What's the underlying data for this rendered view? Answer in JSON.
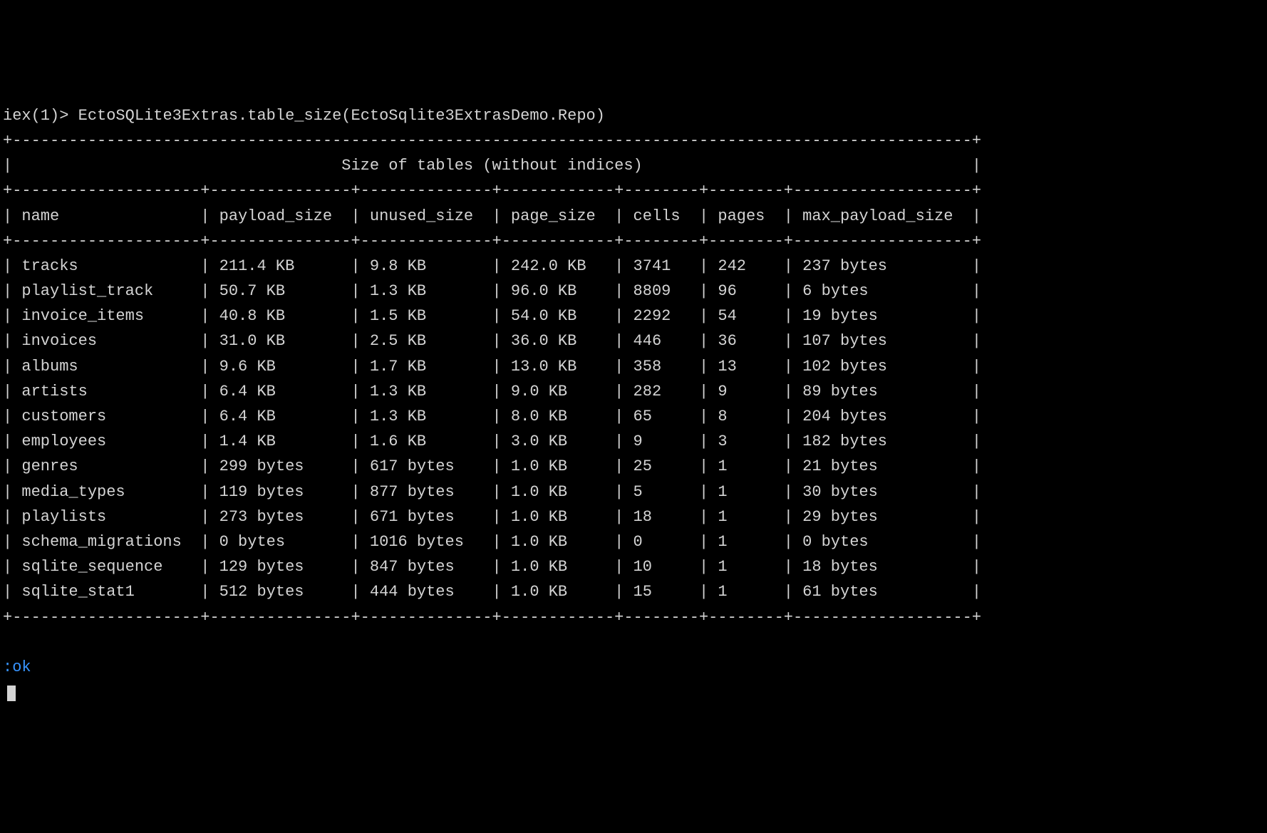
{
  "prompt": {
    "prefix": "iex(1)> ",
    "command": "EctoSQLite3Extras.table_size(EctoSqlite3ExtrasDemo.Repo)"
  },
  "table": {
    "title": "Size of tables (without indices)",
    "columns": [
      "name",
      "payload_size",
      "unused_size",
      "page_size",
      "cells",
      "pages",
      "max_payload_size"
    ],
    "rows": [
      {
        "name": "tracks",
        "payload_size": "211.4 KB",
        "unused_size": "9.8 KB",
        "page_size": "242.0 KB",
        "cells": "3741",
        "pages": "242",
        "max_payload_size": "237 bytes"
      },
      {
        "name": "playlist_track",
        "payload_size": "50.7 KB",
        "unused_size": "1.3 KB",
        "page_size": "96.0 KB",
        "cells": "8809",
        "pages": "96",
        "max_payload_size": "6 bytes"
      },
      {
        "name": "invoice_items",
        "payload_size": "40.8 KB",
        "unused_size": "1.5 KB",
        "page_size": "54.0 KB",
        "cells": "2292",
        "pages": "54",
        "max_payload_size": "19 bytes"
      },
      {
        "name": "invoices",
        "payload_size": "31.0 KB",
        "unused_size": "2.5 KB",
        "page_size": "36.0 KB",
        "cells": "446",
        "pages": "36",
        "max_payload_size": "107 bytes"
      },
      {
        "name": "albums",
        "payload_size": "9.6 KB",
        "unused_size": "1.7 KB",
        "page_size": "13.0 KB",
        "cells": "358",
        "pages": "13",
        "max_payload_size": "102 bytes"
      },
      {
        "name": "artists",
        "payload_size": "6.4 KB",
        "unused_size": "1.3 KB",
        "page_size": "9.0 KB",
        "cells": "282",
        "pages": "9",
        "max_payload_size": "89 bytes"
      },
      {
        "name": "customers",
        "payload_size": "6.4 KB",
        "unused_size": "1.3 KB",
        "page_size": "8.0 KB",
        "cells": "65",
        "pages": "8",
        "max_payload_size": "204 bytes"
      },
      {
        "name": "employees",
        "payload_size": "1.4 KB",
        "unused_size": "1.6 KB",
        "page_size": "3.0 KB",
        "cells": "9",
        "pages": "3",
        "max_payload_size": "182 bytes"
      },
      {
        "name": "genres",
        "payload_size": "299 bytes",
        "unused_size": "617 bytes",
        "page_size": "1.0 KB",
        "cells": "25",
        "pages": "1",
        "max_payload_size": "21 bytes"
      },
      {
        "name": "media_types",
        "payload_size": "119 bytes",
        "unused_size": "877 bytes",
        "page_size": "1.0 KB",
        "cells": "5",
        "pages": "1",
        "max_payload_size": "30 bytes"
      },
      {
        "name": "playlists",
        "payload_size": "273 bytes",
        "unused_size": "671 bytes",
        "page_size": "1.0 KB",
        "cells": "18",
        "pages": "1",
        "max_payload_size": "29 bytes"
      },
      {
        "name": "schema_migrations",
        "payload_size": "0 bytes",
        "unused_size": "1016 bytes",
        "page_size": "1.0 KB",
        "cells": "0",
        "pages": "1",
        "max_payload_size": "0 bytes"
      },
      {
        "name": "sqlite_sequence",
        "payload_size": "129 bytes",
        "unused_size": "847 bytes",
        "page_size": "1.0 KB",
        "cells": "10",
        "pages": "1",
        "max_payload_size": "18 bytes"
      },
      {
        "name": "sqlite_stat1",
        "payload_size": "512 bytes",
        "unused_size": "444 bytes",
        "page_size": "1.0 KB",
        "cells": "15",
        "pages": "1",
        "max_payload_size": "61 bytes"
      }
    ]
  },
  "result": ":ok",
  "widths": {
    "name": 18,
    "payload_size": 13,
    "unused_size": 12,
    "page_size": 10,
    "cells": 6,
    "pages": 6,
    "max_payload_size": 17
  }
}
